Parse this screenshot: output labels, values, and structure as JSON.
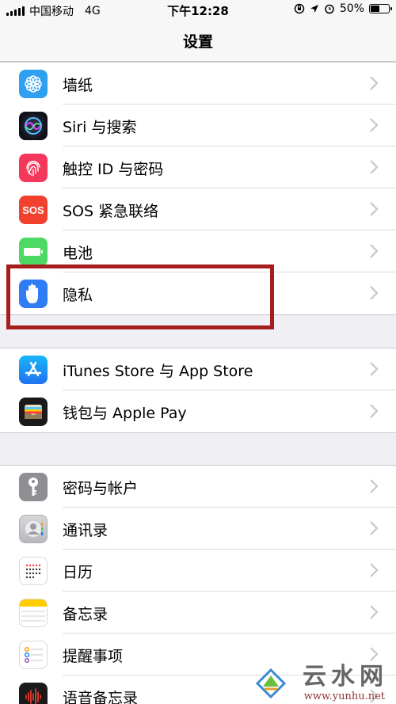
{
  "status_bar": {
    "carrier": "中国移动",
    "network": "4G",
    "time": "下午12:28",
    "battery_percent": "50%",
    "battery_level": 0.5
  },
  "nav": {
    "title": "设置"
  },
  "groups": [
    {
      "items": [
        {
          "label": "墙纸",
          "icon": "wallpaper-icon",
          "color": "#2f9ff0"
        },
        {
          "label": "Siri 与搜索",
          "icon": "siri-icon",
          "color": "#1c1c2c"
        },
        {
          "label": "触控 ID 与密码",
          "icon": "fingerprint-icon",
          "color": "#f5375b"
        },
        {
          "label": "SOS 紧急联络",
          "icon": "sos-icon",
          "color": "#f2402f"
        },
        {
          "label": "电池",
          "icon": "battery-icon",
          "color": "#4cd964"
        },
        {
          "label": "隐私",
          "icon": "privacy-hand-icon",
          "color": "#2f7cf6"
        }
      ]
    },
    {
      "items": [
        {
          "label": "iTunes Store 与 App Store",
          "icon": "app-store-icon",
          "color": "#1e8ff7"
        },
        {
          "label": "钱包与 Apple Pay",
          "icon": "wallet-icon",
          "color": "#1a1a1a"
        }
      ]
    },
    {
      "items": [
        {
          "label": "密码与帐户",
          "icon": "key-icon",
          "color": "#8e8e93"
        },
        {
          "label": "通讯录",
          "icon": "contacts-icon",
          "color": "#c9c9cd"
        },
        {
          "label": "日历",
          "icon": "calendar-icon",
          "color": "#ffffff"
        },
        {
          "label": "备忘录",
          "icon": "notes-icon",
          "color": "#ffffff"
        },
        {
          "label": "提醒事项",
          "icon": "reminders-icon",
          "color": "#ffffff"
        },
        {
          "label": "语音备忘录",
          "icon": "voice-memos-icon",
          "color": "#1a1a1a"
        }
      ]
    }
  ],
  "watermark": {
    "text": "云水网",
    "url": "www.yunhu.net"
  }
}
